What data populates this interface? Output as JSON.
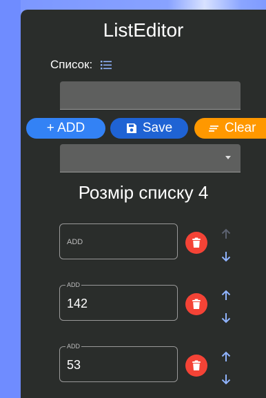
{
  "app": {
    "title": "ListEditor"
  },
  "list_section": {
    "label": "Список:",
    "icon": "list-icon"
  },
  "input": {
    "value": ""
  },
  "buttons": {
    "add": {
      "label": "+ ADD",
      "color": "#3382f5"
    },
    "save": {
      "label": "Save",
      "icon": "save-icon",
      "color": "#1f63d4"
    },
    "clear": {
      "label": "Clear",
      "icon": "clear-lines-icon",
      "color": "#ff9800"
    }
  },
  "select": {
    "value": ""
  },
  "list_size": {
    "text": "Розмір списку 4"
  },
  "items": [
    {
      "label": "ADD",
      "value": "",
      "up_enabled": false
    },
    {
      "label": "ADD",
      "value": "142",
      "up_enabled": true
    },
    {
      "label": "ADD",
      "value": "53",
      "up_enabled": true
    }
  ],
  "colors": {
    "panel": "#2a2d2b",
    "delete": "#f44336",
    "arrow": "#90b4ff",
    "arrow_disabled": "#5c6270"
  }
}
